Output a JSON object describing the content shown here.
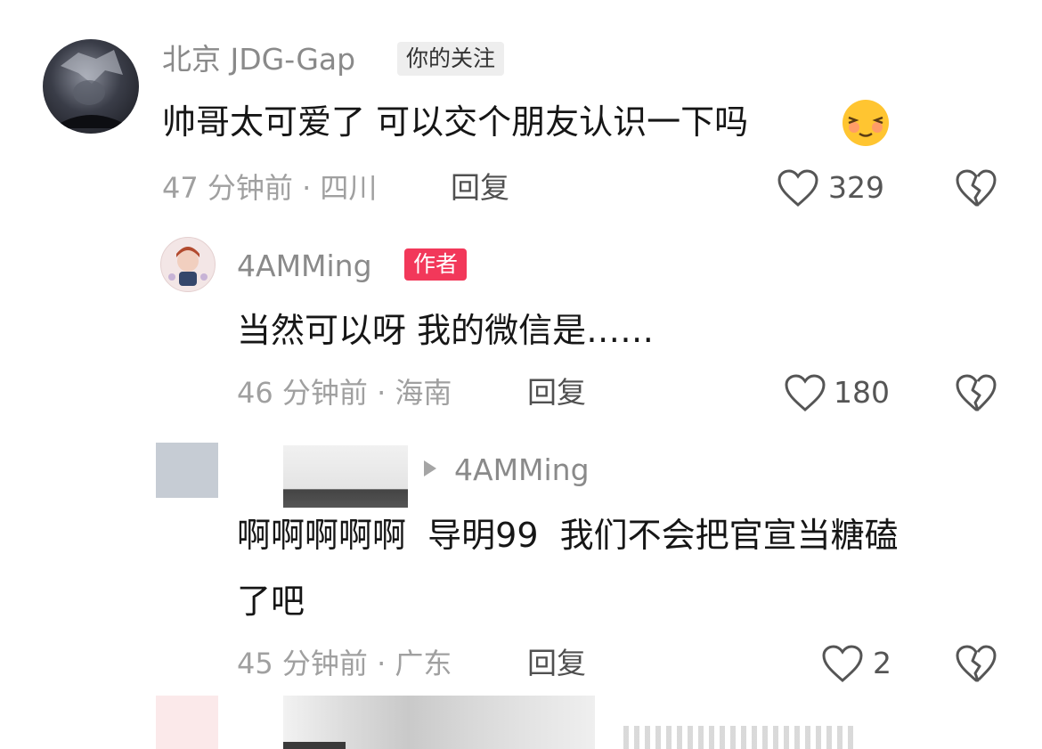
{
  "comments": [
    {
      "username": "北京 JDG-Gap",
      "badge": "你的关注",
      "text": "帅哥太可爱了 可以交个朋友认识一下吗",
      "emoji": "shy-smile-emoji",
      "time": "47 分钟前",
      "location": "· 四川",
      "reply_label": "回复",
      "likes": "329"
    },
    {
      "username": "4AMMing",
      "badge": "作者",
      "text": "当然可以呀 我的微信是……",
      "time": "46 分钟前",
      "location": "· 海南",
      "reply_label": "回复",
      "likes": "180"
    },
    {
      "reply_to": "4AMMing",
      "text_line1": "啊啊啊啊啊  导明99  我们不会把官宣当糖磕",
      "text_line2": "了吧",
      "time": "45 分钟前",
      "location": "· 广东",
      "reply_label": "回复",
      "likes": "2"
    }
  ],
  "colors": {
    "author_badge": "#f2385a",
    "follow_badge_bg": "#eeeeee",
    "meta_text": "#a0a0a0"
  }
}
